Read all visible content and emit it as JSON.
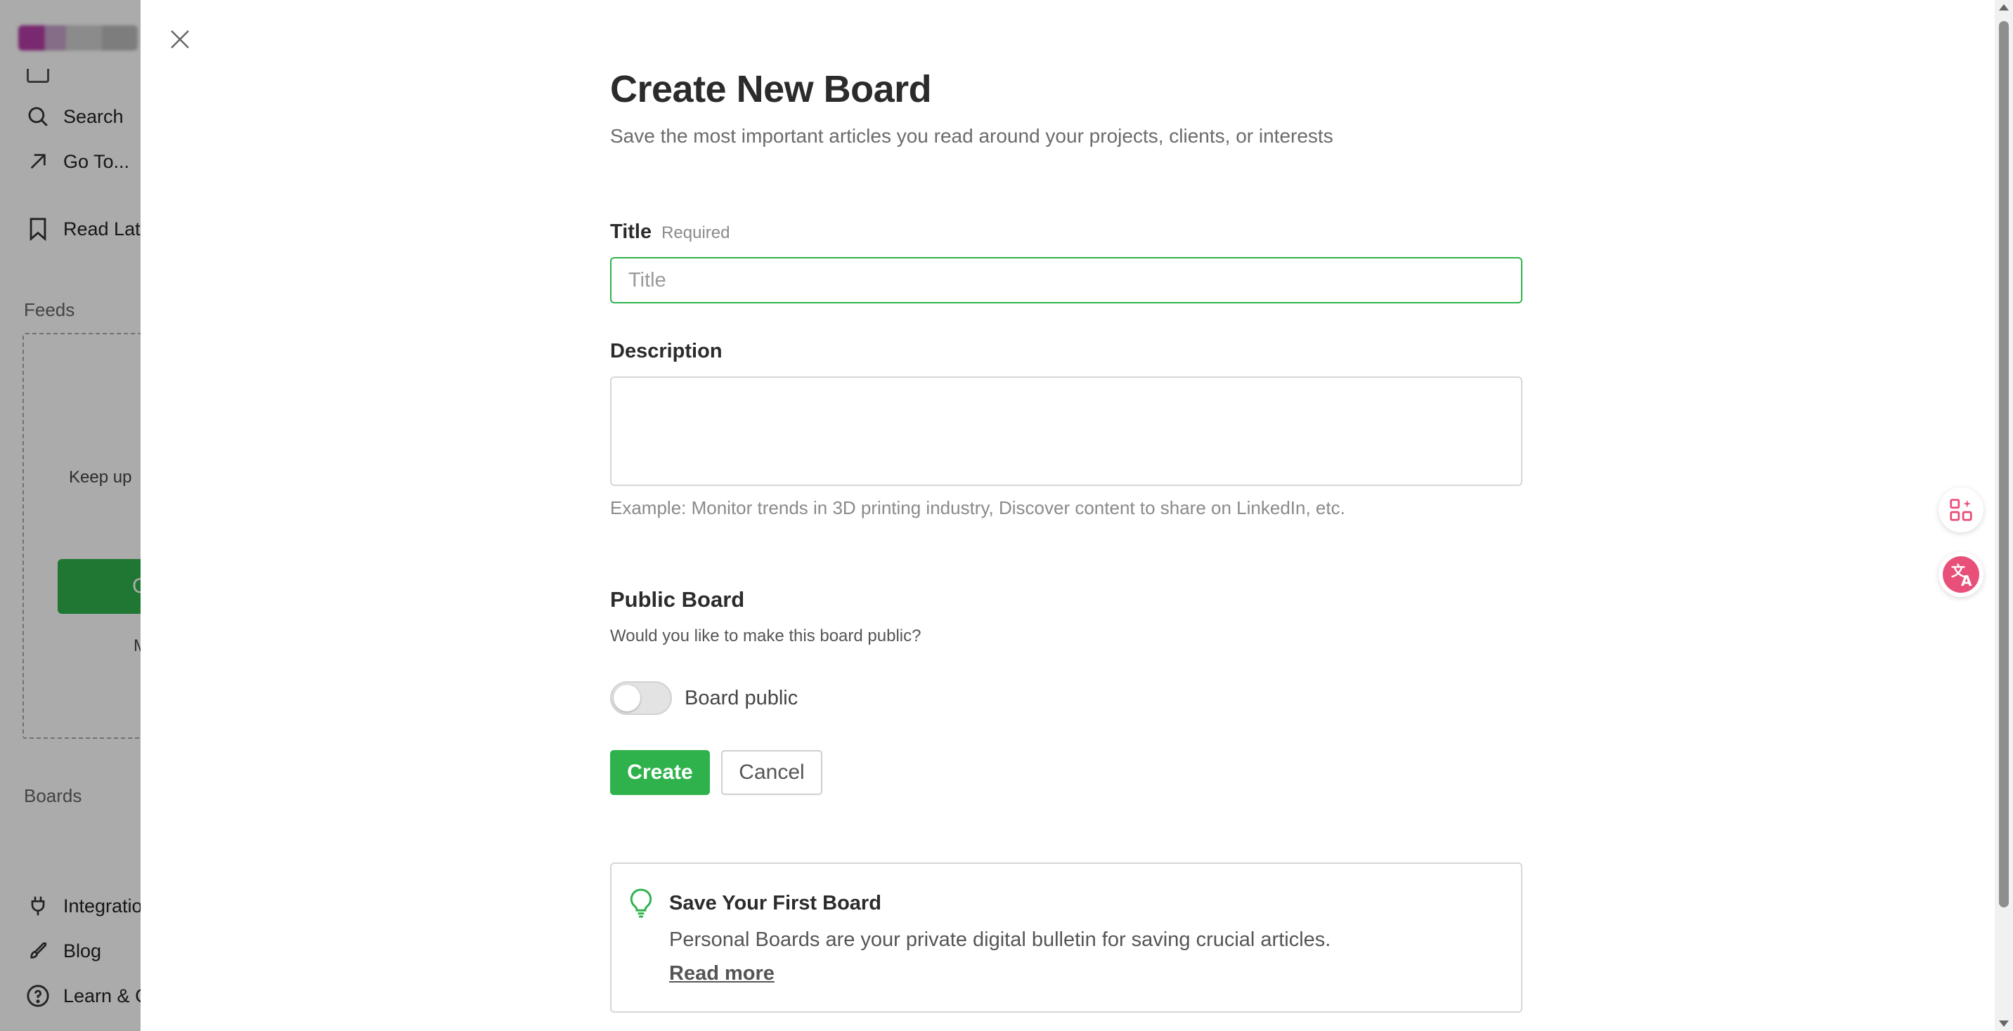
{
  "sidebar": {
    "items_top": [
      {
        "label": "Search",
        "icon": "search-icon"
      },
      {
        "label": "Go To...",
        "icon": "arrow-up-right-icon"
      },
      {
        "label": "Read Late",
        "icon": "bookmark-icon"
      }
    ],
    "feeds_section": "Feeds",
    "feeds_empty_text": "Keep up",
    "feeds_button_partial": "C",
    "feeds_more_partial": "M",
    "boards_section": "Boards",
    "items_bottom": [
      {
        "label": "Integratio",
        "icon": "plug-icon"
      },
      {
        "label": "Blog",
        "icon": "rocket-icon"
      },
      {
        "label": "Learn & C",
        "icon": "help-circle-icon"
      }
    ]
  },
  "modal": {
    "heading": "Create New Board",
    "subtitle": "Save the most important articles you read around your projects, clients, or interests",
    "title_field": {
      "label": "Title",
      "required_text": "Required",
      "placeholder": "Title",
      "value": ""
    },
    "description_field": {
      "label": "Description",
      "value": "",
      "hint": "Example: Monitor trends in 3D printing industry, Discover content to share on LinkedIn, etc."
    },
    "public_board": {
      "heading": "Public Board",
      "question": "Would you like to make this board public?",
      "toggle_label": "Board public",
      "toggle_on": false
    },
    "buttons": {
      "create": "Create",
      "cancel": "Cancel"
    },
    "tip": {
      "title": "Save Your First Board",
      "text": "Personal Boards are your private digital bulletin for saving crucial articles.",
      "link": "Read more"
    }
  },
  "colors": {
    "accent_green": "#2fb24c",
    "overlay": "rgba(0,0,0,0.33)",
    "extension_pink": "#e8507a"
  }
}
